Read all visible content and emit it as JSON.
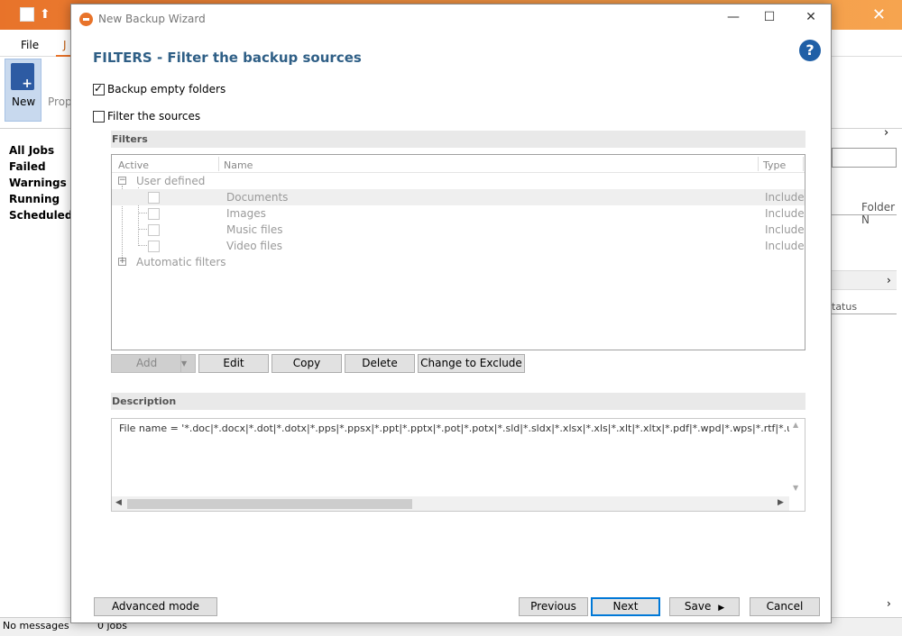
{
  "background_app": {
    "menu": {
      "file": "File",
      "second_tab": "J"
    },
    "ribbon": {
      "new_label": "New",
      "properties_label": "Prop"
    },
    "sidebar": [
      "All Jobs",
      "Failed",
      "Warnings",
      "Running",
      "Scheduled"
    ],
    "right_panel": {
      "folder_header": "Folder N",
      "status_header": "tatus"
    },
    "statusbar": {
      "messages": "No messages",
      "jobs": "0 jobs"
    }
  },
  "dialog": {
    "title": "New Backup Wizard",
    "heading": "FILTERS - Filter the backup sources",
    "help_icon": "question-icon",
    "backup_empty_folders": {
      "label": "Backup empty folders",
      "checked": true
    },
    "filter_sources": {
      "label": "Filter the sources",
      "checked": false
    },
    "filters_section": "Filters",
    "columns": {
      "active": "Active",
      "name": "Name",
      "type": "Type"
    },
    "tree": {
      "user_defined": "User defined",
      "items": [
        {
          "name": "Documents",
          "type": "Include"
        },
        {
          "name": "Images",
          "type": "Include"
        },
        {
          "name": "Music files",
          "type": "Include"
        },
        {
          "name": "Video files",
          "type": "Include"
        }
      ],
      "automatic_filters": "Automatic filters"
    },
    "filter_buttons": {
      "add": "Add",
      "edit": "Edit",
      "copy": "Copy",
      "delete": "Delete",
      "change": "Change to Exclude"
    },
    "description_section": "Description",
    "description_text": "File name = '*.doc|*.docx|*.dot|*.dotx|*.pps|*.ppsx|*.ppt|*.pptx|*.pot|*.potx|*.sld|*.sldx|*.xlsx|*.xls|*.xlt|*.xltx|*.pdf|*.wpd|*.wps|*.rtf|*.uof|*.uot|",
    "footer": {
      "advanced": "Advanced mode",
      "previous": "Previous",
      "next": "Next",
      "save": "Save",
      "cancel": "Cancel"
    }
  }
}
